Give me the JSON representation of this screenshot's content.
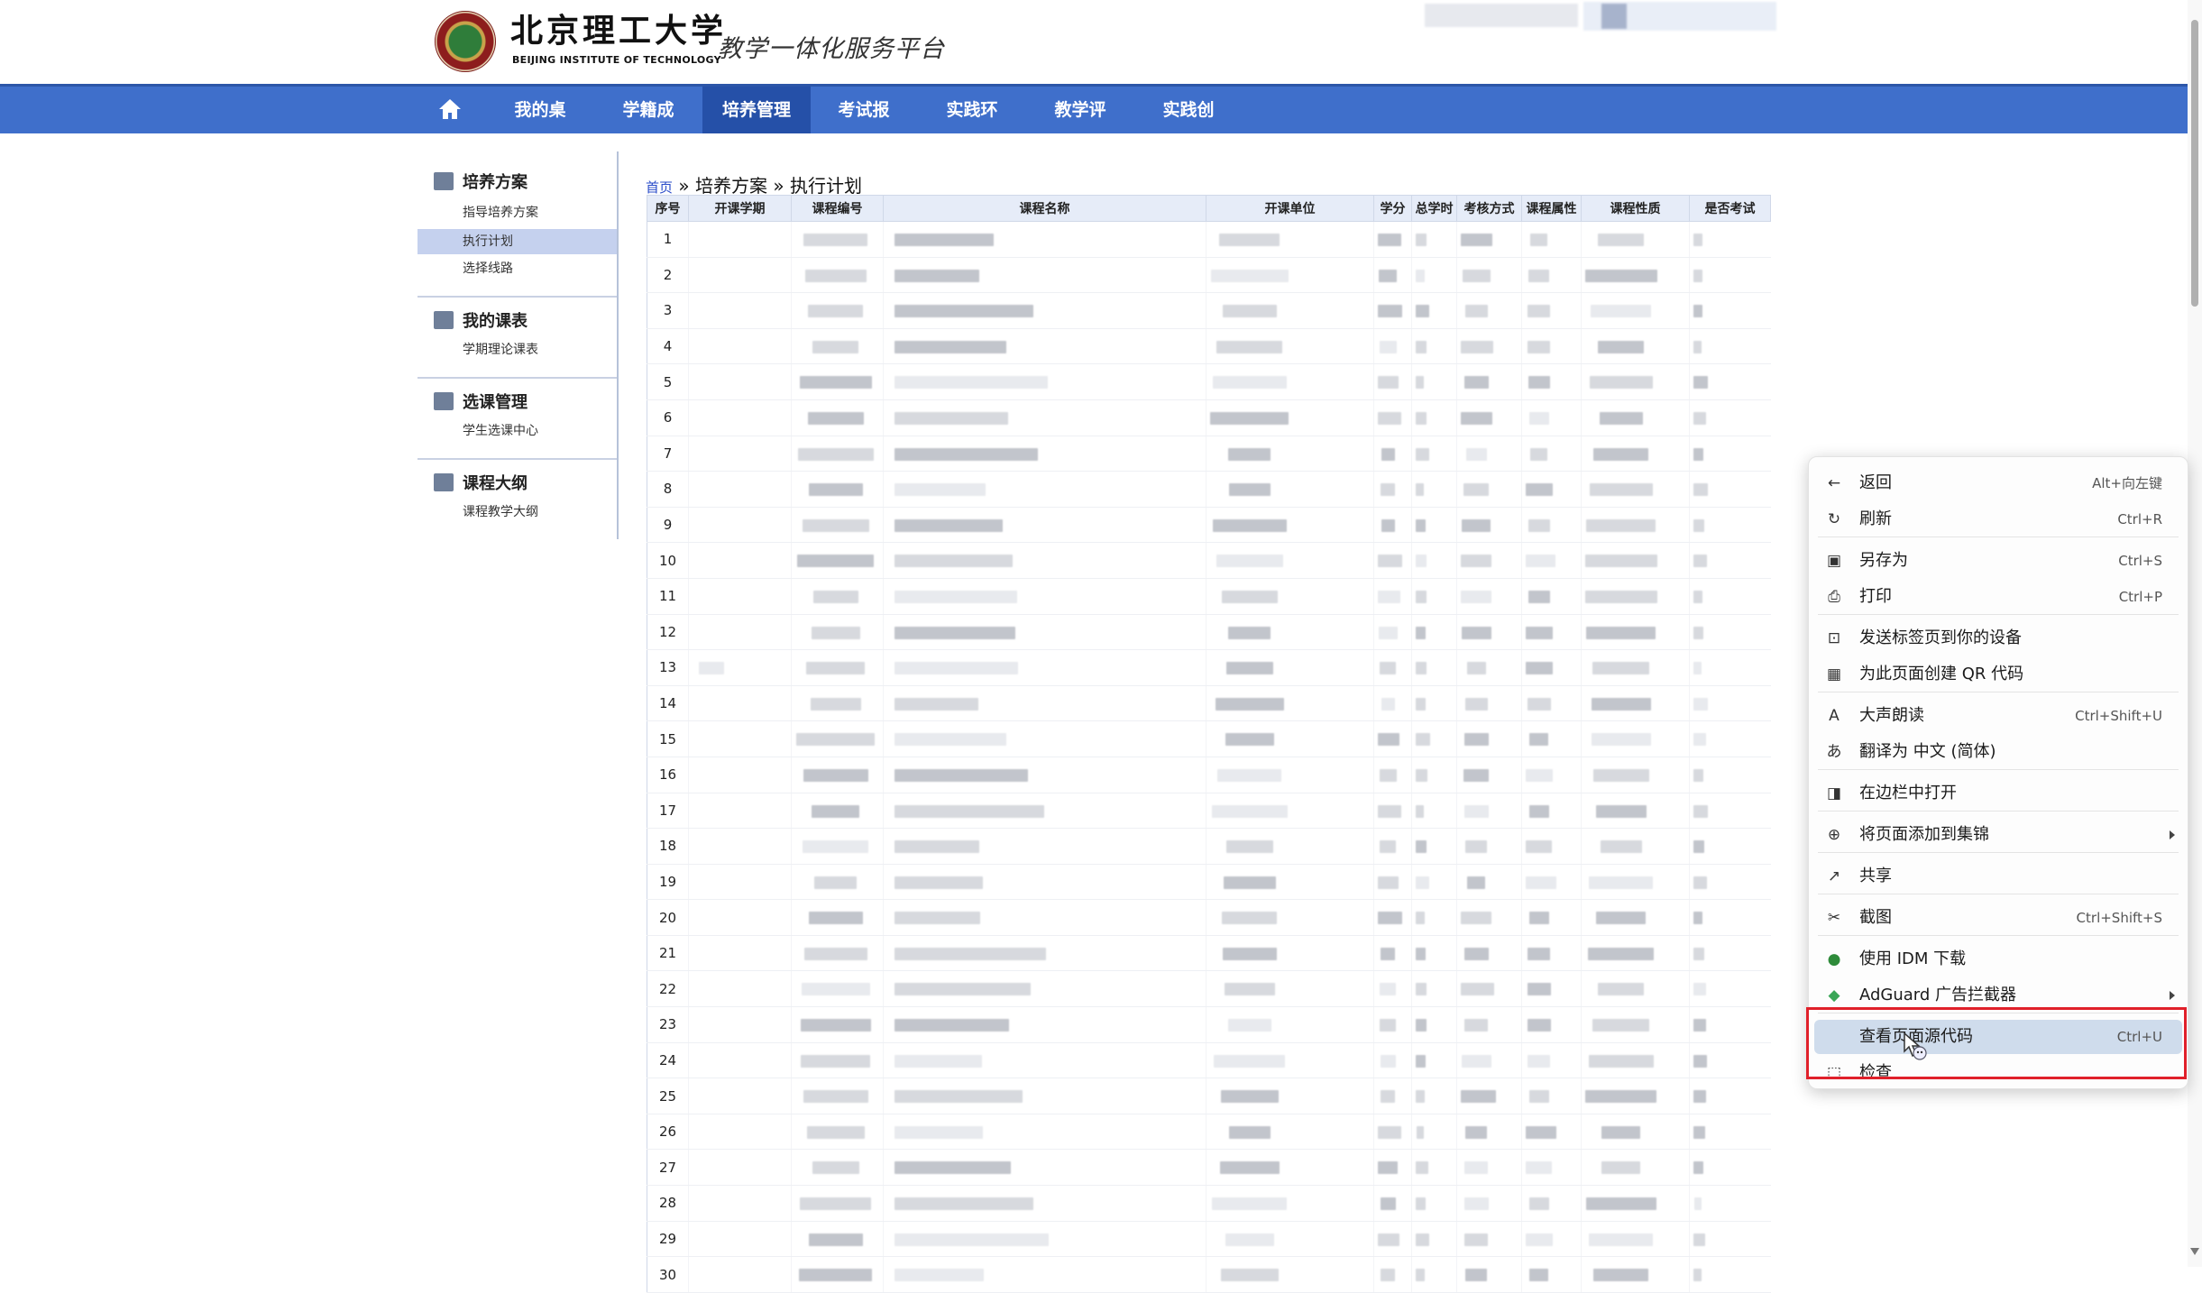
{
  "header": {
    "logo_name": "北京理工大学",
    "logo_en": "BEIJING INSTITUTE OF TECHNOLOGY",
    "platform_title": "教学一体化服务平台"
  },
  "nav": {
    "home_icon": "home-icon",
    "items": [
      {
        "label": "我的桌面",
        "active": false
      },
      {
        "label": "学籍成绩",
        "active": false
      },
      {
        "label": "培养管理",
        "active": true
      },
      {
        "label": "考试报名",
        "active": false
      },
      {
        "label": "实践环节",
        "active": false
      },
      {
        "label": "教学评价",
        "active": false
      },
      {
        "label": "实践创新",
        "active": false
      }
    ]
  },
  "sidebar": {
    "groups": [
      {
        "title": "培养方案",
        "links": [
          {
            "label": "指导培养方案",
            "active": false
          },
          {
            "label": "执行计划",
            "active": true
          },
          {
            "label": "选择线路",
            "active": false
          }
        ]
      },
      {
        "title": "我的课表",
        "links": [
          {
            "label": "学期理论课表",
            "active": false
          }
        ]
      },
      {
        "title": "选课管理",
        "links": [
          {
            "label": "学生选课中心",
            "active": false
          }
        ]
      },
      {
        "title": "课程大纲",
        "links": [
          {
            "label": "课程教学大纲",
            "active": false
          }
        ]
      }
    ]
  },
  "breadcrumb": {
    "home": "首页",
    "sep": "»",
    "level1": "培养方案",
    "level2": "执行计划"
  },
  "table": {
    "headers": [
      "序号",
      "开课学期",
      "课程编号",
      "课程名称",
      "开课单位",
      "学分",
      "总学时",
      "考核方式",
      "课程属性",
      "课程性质",
      "是否考试"
    ],
    "rows": [
      "1",
      "2",
      "3",
      "4",
      "5",
      "6",
      "7",
      "8",
      "9",
      "10",
      "11",
      "12",
      "13",
      "14",
      "15",
      "16",
      "17",
      "18",
      "19",
      "20",
      "21",
      "22",
      "23",
      "24",
      "25",
      "26",
      "27",
      "28",
      "29",
      "30"
    ]
  },
  "context_menu": {
    "items": [
      {
        "label": "返回",
        "shortcut": "Alt+向左键",
        "icon": "back-arrow-icon"
      },
      {
        "label": "刷新",
        "shortcut": "Ctrl+R",
        "icon": "refresh-icon"
      },
      {
        "label": "另存为",
        "shortcut": "Ctrl+S",
        "icon": "save-as-icon"
      },
      {
        "label": "打印",
        "shortcut": "Ctrl+P",
        "icon": "print-icon"
      },
      {
        "label": "发送标签页到你的设备",
        "shortcut": "",
        "icon": "send-to-device-icon"
      },
      {
        "label": "为此页面创建 QR 代码",
        "shortcut": "",
        "icon": "qr-code-icon"
      },
      {
        "label": "大声朗读",
        "shortcut": "Ctrl+Shift+U",
        "icon": "read-aloud-icon"
      },
      {
        "label": "翻译为 中文 (简体)",
        "shortcut": "",
        "icon": "translate-icon"
      },
      {
        "label": "在边栏中打开",
        "shortcut": "",
        "icon": "sidebar-open-icon"
      },
      {
        "label": "将页面添加到集锦",
        "shortcut": "",
        "icon": "collections-icon",
        "submenu": true
      },
      {
        "label": "共享",
        "shortcut": "",
        "icon": "share-icon"
      },
      {
        "label": "截图",
        "shortcut": "Ctrl+Shift+S",
        "icon": "screenshot-icon"
      },
      {
        "label": "使用 IDM 下载",
        "shortcut": "",
        "icon": "idm-icon"
      },
      {
        "label": "AdGuard 广告拦截器",
        "shortcut": "",
        "icon": "adguard-shield-icon",
        "submenu": true
      },
      {
        "label": "查看页面源代码",
        "shortcut": "Ctrl+U",
        "icon": "",
        "highlighted": true
      },
      {
        "label": "检查",
        "shortcut": "",
        "icon": "inspect-icon"
      }
    ]
  },
  "colors": {
    "nav_bg": "#3f6fcb",
    "nav_active": "#2550a8",
    "highlight_box": "#e0202a",
    "menu_highlight": "#cfdcec"
  }
}
